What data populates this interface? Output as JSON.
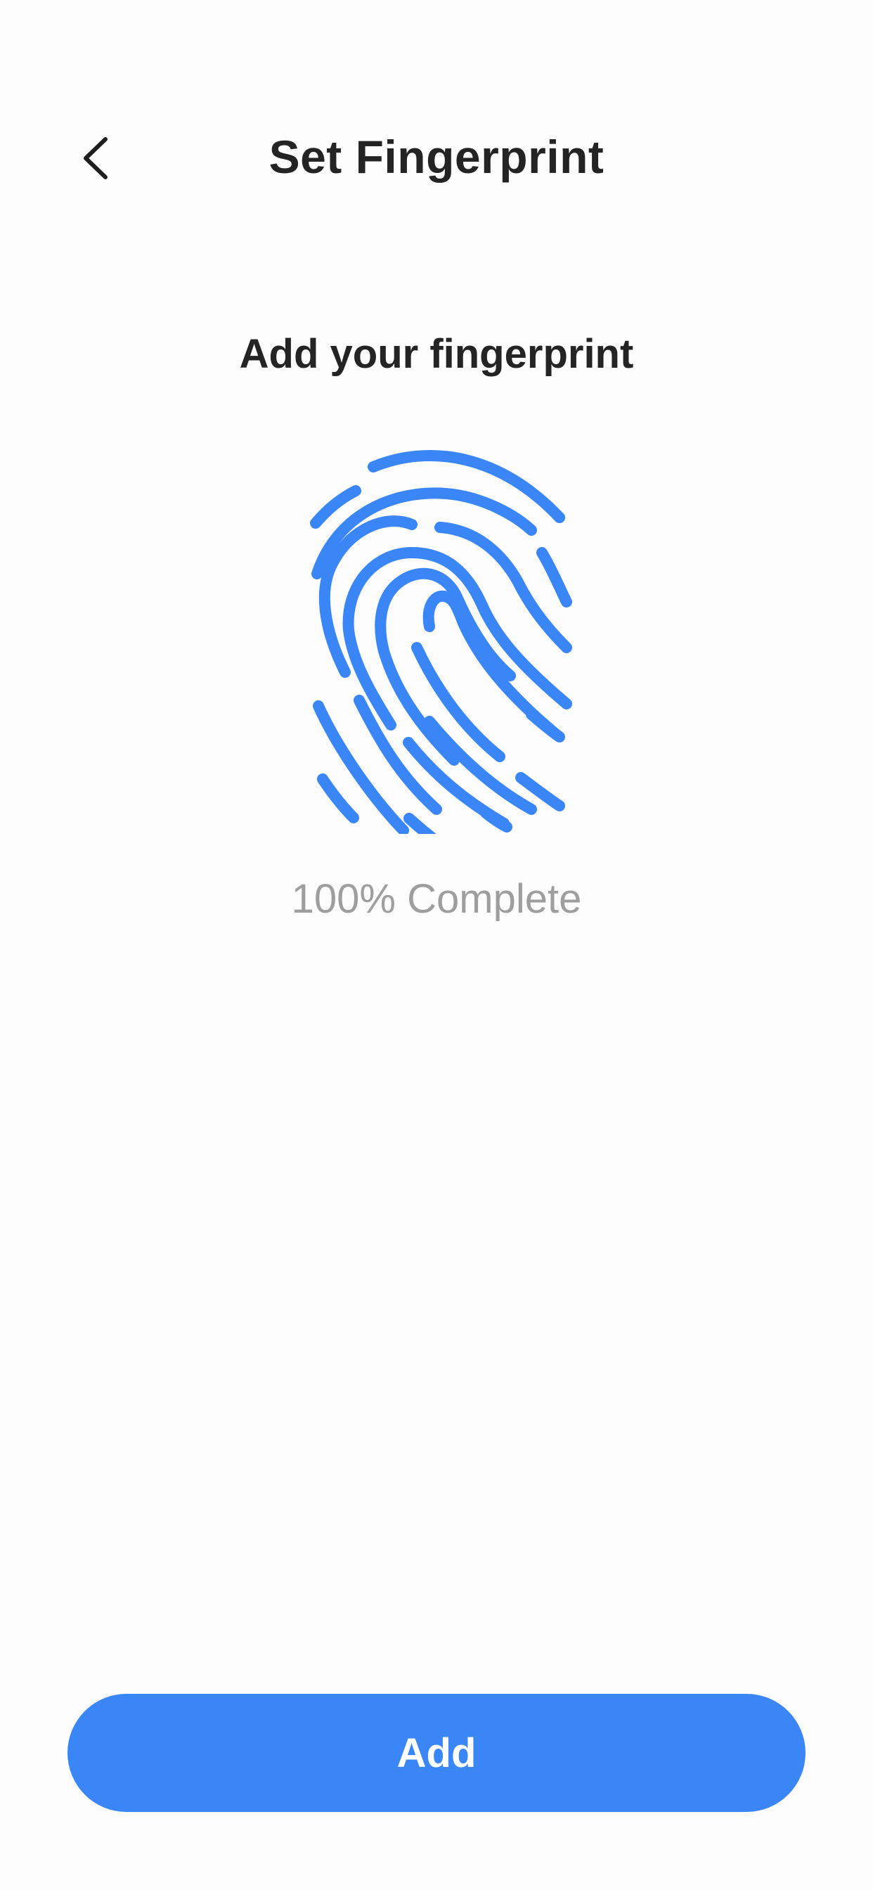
{
  "header": {
    "title": "Set Fingerprint",
    "back_icon": "chevron-left-icon"
  },
  "main": {
    "subtitle": "Add your fingerprint",
    "fingerprint_icon": "fingerprint-icon",
    "progress_text": "100% Complete",
    "progress_percent": 100
  },
  "footer": {
    "add_label": "Add"
  },
  "colors": {
    "accent": "#3A86F7",
    "title_text": "#242424",
    "muted_text": "#9E9E9E",
    "background": "#FDFDFD"
  }
}
